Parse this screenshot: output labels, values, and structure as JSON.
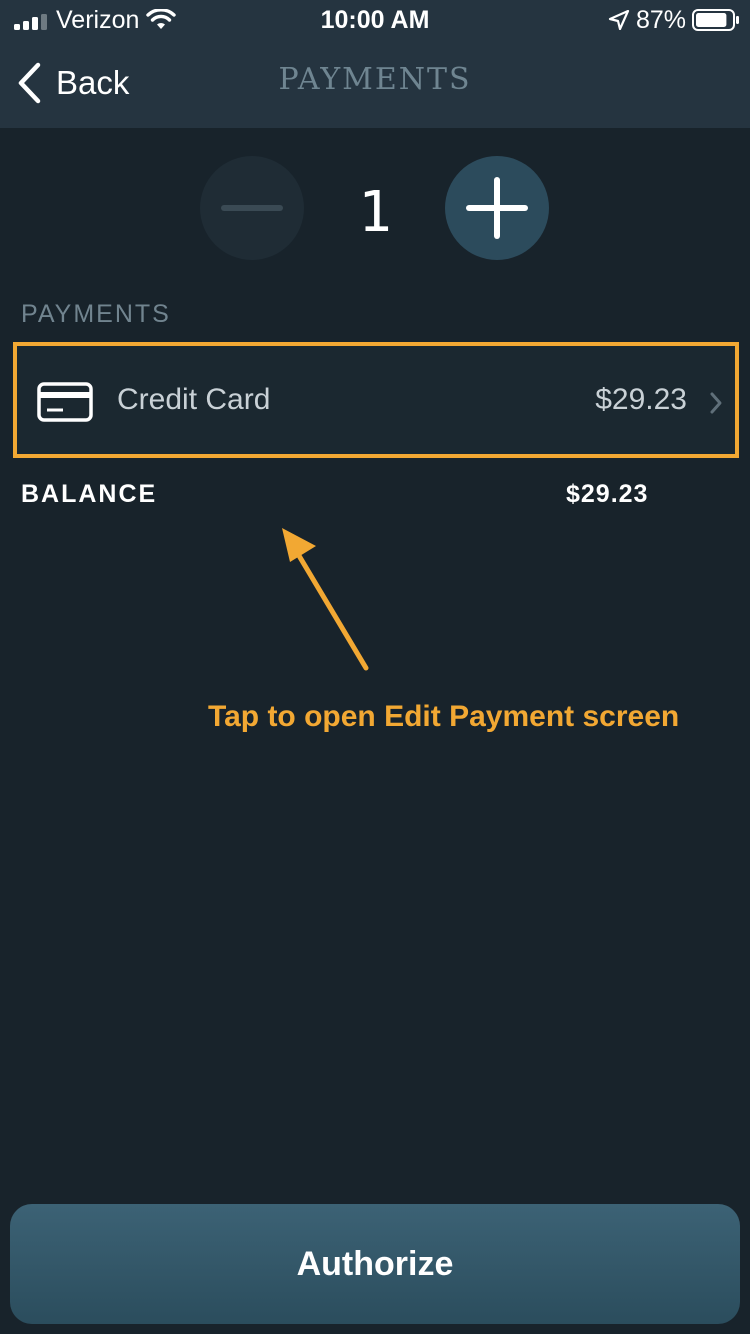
{
  "status_bar": {
    "carrier": "Verizon",
    "time": "10:00 AM",
    "battery": "87%",
    "battery_level": 0.87
  },
  "nav": {
    "back_label": "Back",
    "title": "PAYMENTS"
  },
  "stepper": {
    "value": "1"
  },
  "payments": {
    "section_label": "PAYMENTS",
    "items": [
      {
        "method": "Credit Card",
        "amount": "$29.23",
        "icon": "credit-card-icon"
      }
    ]
  },
  "balance": {
    "label": "BALANCE",
    "value": "$29.23"
  },
  "annotation": {
    "text": "Tap to open Edit Payment screen",
    "color": "#f2a833"
  },
  "footer": {
    "authorize_label": "Authorize"
  },
  "colors": {
    "background": "#18232b",
    "header": "#253440",
    "accent": "#f2a833",
    "button": "#2c4b5c"
  }
}
